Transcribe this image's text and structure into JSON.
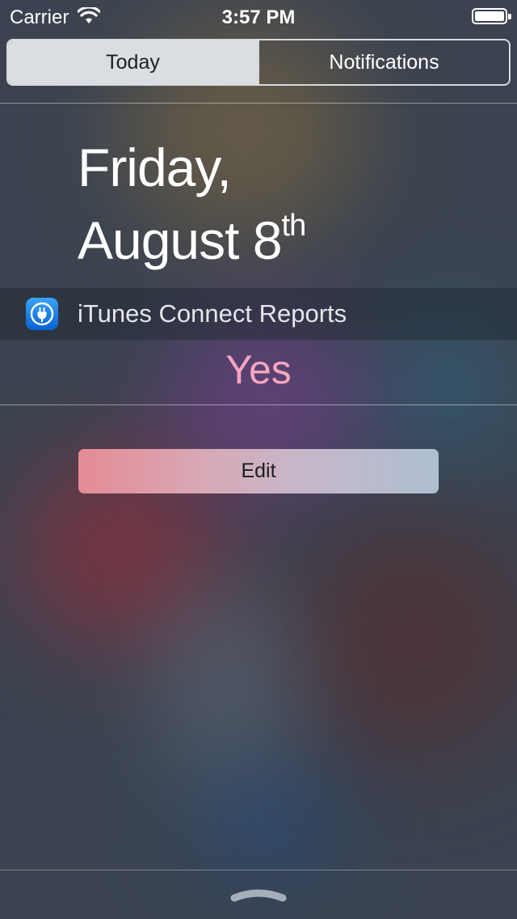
{
  "status_bar": {
    "carrier": "Carrier",
    "time": "3:57 PM",
    "wifi_icon": "wifi-icon",
    "battery_icon": "battery-icon"
  },
  "segmented_control": {
    "today_label": "Today",
    "notifications_label": "Notifications",
    "selected": "Today"
  },
  "date": {
    "weekday": "Friday,",
    "month_day": "August 8",
    "ordinal_suffix": "th"
  },
  "widget": {
    "icon": "itunes-connect-app-icon",
    "title": "iTunes Connect Reports",
    "value": "Yes"
  },
  "edit_label": "Edit",
  "grabber_icon": "chevron-up-grabber-icon",
  "colors": {
    "accent_text": "#ffffff",
    "segment_active_bg": "#dadde2",
    "app_icon_blue": "#1a7fe8"
  }
}
